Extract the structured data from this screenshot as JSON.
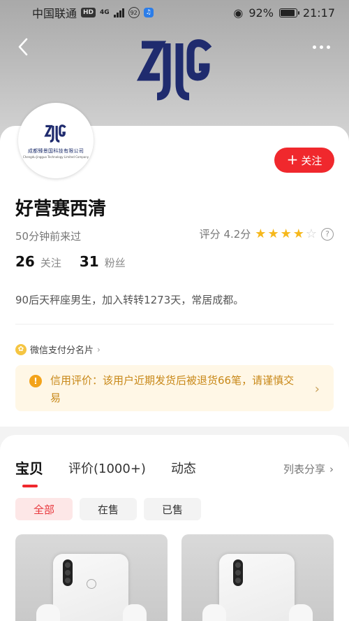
{
  "status_bar": {
    "carrier": "中国联通",
    "network_badge": "HD",
    "network_type": "4G",
    "notification_count": "92",
    "battery": "92%",
    "time": "21:17"
  },
  "header": {
    "logo_text": "ZJG",
    "back_icon": "chevron-left-icon",
    "more_icon": "more-dots-icon"
  },
  "profile": {
    "avatar_logo": "ZJG",
    "avatar_company_cn": "成都臻景国科技有限公司",
    "avatar_company_en": "Chengdu Jingguo Technology Limited Company",
    "follow_label": "关注",
    "follow_plus": "+",
    "name": "好营赛西清",
    "last_seen": "50分钟前来过",
    "rating_label": "评分 4.2分",
    "rating_value": 4.2,
    "stars_filled": 4,
    "stars_total": 5,
    "help_icon_char": "?",
    "follow_count": "26",
    "follow_count_label": "关注",
    "fans_count": "31",
    "fans_count_label": "粉丝",
    "bio": "90后天秤座男生，加入转转1273天，常居成都。",
    "wechat_label": "微信支付分名片",
    "wechat_chevron": "›",
    "credit_alert": "信用评价：该用户近期发货后被退货66笔，请谨慎交易",
    "alert_icon_char": "!",
    "alert_chevron": "›"
  },
  "colors": {
    "accent_red": "#f0282d",
    "star_yellow": "#f6b81c",
    "alert_bg": "#fff7e6",
    "alert_text": "#c88818",
    "brand_navy": "#1c2d6b"
  },
  "tabs": {
    "items": [
      "宝贝",
      "评价(1000+)",
      "动态"
    ],
    "active_index": 0,
    "share_label": "列表分享",
    "share_chevron": "›"
  },
  "filters": {
    "items": [
      "全部",
      "在售",
      "已售"
    ],
    "active_index": 0
  }
}
